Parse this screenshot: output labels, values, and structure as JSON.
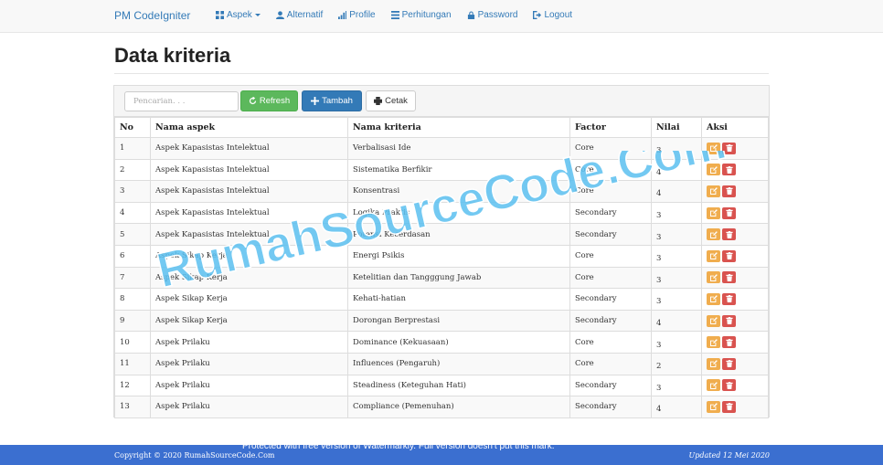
{
  "navbar": {
    "brand": "PM CodeIgniter",
    "items": [
      {
        "label": "Aspek",
        "icon": "grid-icon",
        "dropdown": true
      },
      {
        "label": "Alternatif",
        "icon": "user-icon"
      },
      {
        "label": "Profile",
        "icon": "bar-chart-icon"
      },
      {
        "label": "Perhitungan",
        "icon": "list-icon"
      },
      {
        "label": "Password",
        "icon": "lock-icon"
      },
      {
        "label": "Logout",
        "icon": "logout-icon"
      }
    ]
  },
  "page": {
    "title": "Data kriteria"
  },
  "toolbar": {
    "search_placeholder": "Pencarian. . .",
    "refresh_label": "Refresh",
    "tambah_label": "Tambah",
    "cetak_label": "Cetak"
  },
  "table": {
    "headers": [
      "No",
      "Nama aspek",
      "Nama kriteria",
      "Factor",
      "Nilai",
      "Aksi"
    ],
    "rows": [
      [
        "1",
        "Aspek Kapasistas Intelektual",
        "Verbalisasi Ide",
        "Core",
        "3"
      ],
      [
        "2",
        "Aspek Kapasistas Intelektual",
        "Sistematika Berfikir",
        "Core",
        "4"
      ],
      [
        "3",
        "Aspek Kapasistas Intelektual",
        "Konsentrasi",
        "Core",
        "4"
      ],
      [
        "4",
        "Aspek Kapasistas Intelektual",
        "Logika Praktis",
        "Secondary",
        "3"
      ],
      [
        "5",
        "Aspek Kapasistas Intelektual",
        "Potensi Kecerdasan",
        "Secondary",
        "3"
      ],
      [
        "6",
        "Aspek Sikap Kerja",
        "Energi Psikis",
        "Core",
        "3"
      ],
      [
        "7",
        "Aspek Sikap Kerja",
        "Ketelitian dan Tangggung Jawab",
        "Core",
        "3"
      ],
      [
        "8",
        "Aspek Sikap Kerja",
        "Kehati-hatian",
        "Secondary",
        "3"
      ],
      [
        "9",
        "Aspek Sikap Kerja",
        "Dorongan Berprestasi",
        "Secondary",
        "4"
      ],
      [
        "10",
        "Aspek Prilaku",
        "Dominance (Kekuasaan)",
        "Core",
        "3"
      ],
      [
        "11",
        "Aspek Prilaku",
        "Influences (Pengaruh)",
        "Core",
        "2"
      ],
      [
        "12",
        "Aspek Prilaku",
        "Steadiness (Keteguhan Hati)",
        "Secondary",
        "3"
      ],
      [
        "13",
        "Aspek Prilaku",
        "Compliance (Pemenuhan)",
        "Secondary",
        "4"
      ]
    ]
  },
  "watermark": {
    "text": "RumahSourceCode.Com",
    "color": "#5bc0f0"
  },
  "footer": {
    "copyright": "Copyright © 2020 RumahSourceCode.Com",
    "updated": "Updated 12 Mei 2020",
    "protect_notice": "Protected with free version of Watermarkly. Full version doesn't put this mark.",
    "color": "#3b6fd0"
  }
}
